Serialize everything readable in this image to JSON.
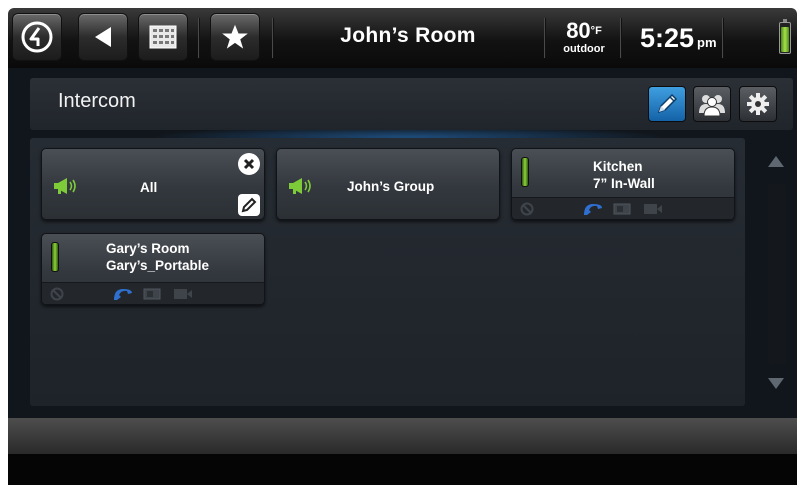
{
  "header": {
    "title": "John’s Room",
    "temperature": "80",
    "temperature_unit": "°F",
    "temperature_label": "outdoor",
    "time": "5:25",
    "ampm": "pm",
    "battery_level": 0.85,
    "icons": [
      "logo-icon",
      "back-icon",
      "keypad-icon",
      "favorites-star-icon",
      "battery-icon"
    ]
  },
  "subheader": {
    "title": "Intercom",
    "buttons": [
      "edit-pencil-icon",
      "groups-icon",
      "settings-gear-icon"
    ]
  },
  "cards": [
    {
      "name": "All",
      "type": "group",
      "icons": [
        "megaphone-icon",
        "delete-icon",
        "edit-icon"
      ]
    },
    {
      "name": "John’s Group",
      "type": "group",
      "icons": [
        "megaphone-icon"
      ]
    },
    {
      "line1": "Kitchen",
      "line2": "7” In-Wall",
      "type": "device",
      "icons": [
        "level-meter-icon",
        "dnd-icon",
        "call-icon",
        "monitor-icon",
        "video-icon"
      ]
    },
    {
      "line1": "Gary’s Room",
      "line2": "Gary’s_Portable",
      "type": "device",
      "icons": [
        "level-meter-icon",
        "dnd-icon",
        "call-icon",
        "monitor-icon",
        "video-icon"
      ]
    }
  ],
  "colors": {
    "accent_green": "#7ecb3a",
    "call_blue": "#2e6fd0",
    "active_blue": "#2a86d0"
  }
}
